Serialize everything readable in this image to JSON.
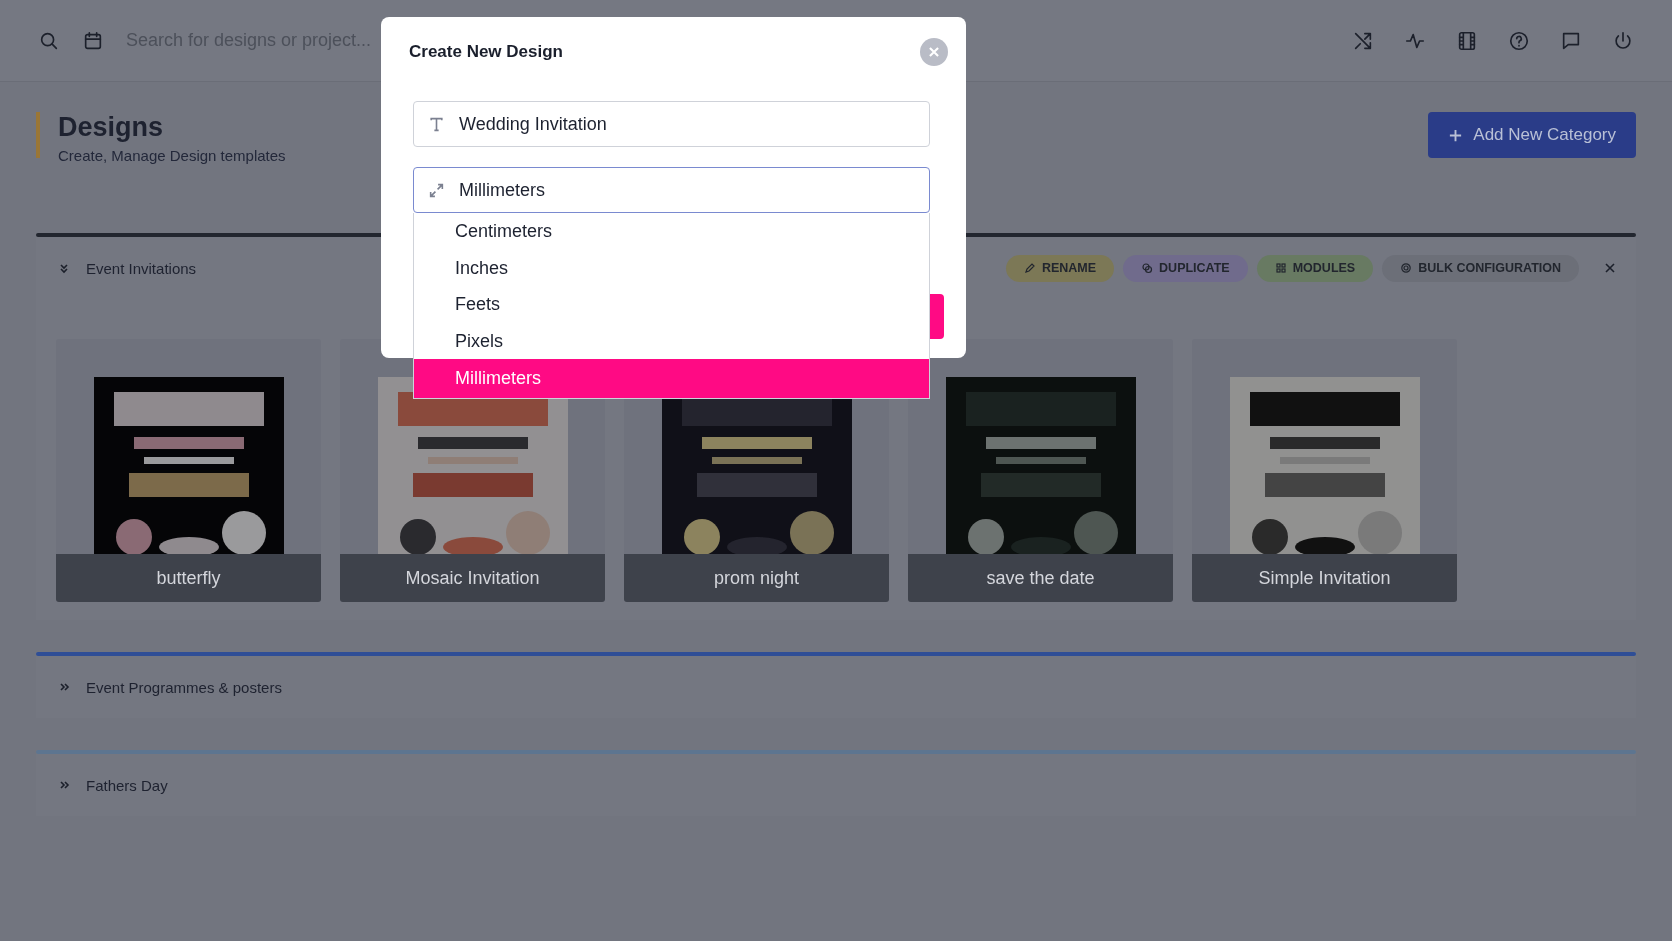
{
  "top_bar": {
    "search": {
      "placeholder": "Search for designs or project..."
    }
  },
  "header": {
    "title": "Designs",
    "subtitle": "Create, Manage Design templates",
    "add_button": "Add New Category"
  },
  "sections": [
    {
      "title": "Event Invitations",
      "expanded": true,
      "color": "#22262f",
      "actions": [
        {
          "label": "RENAME",
          "color": "#7c7856"
        },
        {
          "label": "DUPLICATE",
          "color": "#706b8c"
        },
        {
          "label": "MODULES",
          "color": "#687a62"
        },
        {
          "label": "BULK CONFIGURATION",
          "color": "#6c6f78"
        }
      ],
      "cards": [
        {
          "caption": "butterfly",
          "kind": "picture"
        },
        {
          "caption": "Mosaic Invitation",
          "kind": "picture"
        },
        {
          "caption": "prom night",
          "kind": "picture"
        },
        {
          "caption": "save the date",
          "kind": "picture"
        },
        {
          "caption": "Simple Invitation",
          "kind": "picture"
        }
      ]
    },
    {
      "title": "Event Programmes & posters",
      "expanded": false,
      "color": "#2f4e96"
    },
    {
      "title": "Fathers Day",
      "expanded": false,
      "color": "#5d7590"
    }
  ],
  "modal": {
    "title": "Create New Design",
    "name_field": {
      "value": "Wedding Invitation"
    },
    "unit_field": {
      "value": "Millimeters"
    },
    "unit_options": [
      {
        "label": "Centimeters",
        "selected": false
      },
      {
        "label": "Inches",
        "selected": false
      },
      {
        "label": "Feets",
        "selected": false
      },
      {
        "label": "Pixels",
        "selected": false
      },
      {
        "label": "Millimeters",
        "selected": true
      }
    ]
  }
}
